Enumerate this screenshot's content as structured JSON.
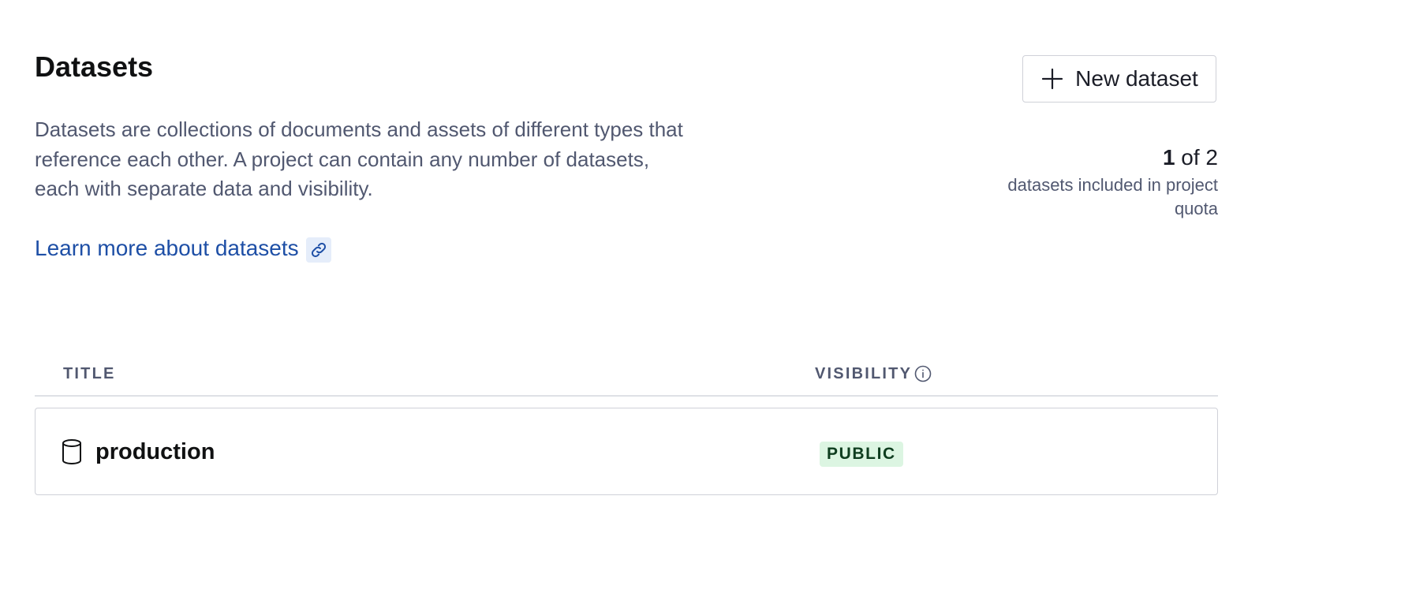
{
  "header": {
    "title": "Datasets",
    "description": "Datasets are collections of documents and assets of different types that reference each other. A project can contain any number of datasets, each with separate data and visibility.",
    "learn_more_label": "Learn more about datasets",
    "new_dataset_label": "New dataset"
  },
  "quota": {
    "used": "1",
    "of_total": "of 2",
    "label": "datasets included in project quota"
  },
  "table": {
    "columns": {
      "title": "TITLE",
      "visibility": "VISIBILITY"
    },
    "rows": [
      {
        "title": "production",
        "visibility": "PUBLIC"
      }
    ]
  },
  "colors": {
    "link": "#1e4fa6",
    "badge_bg": "#dcf5e2",
    "badge_text": "#0e3d1f"
  }
}
